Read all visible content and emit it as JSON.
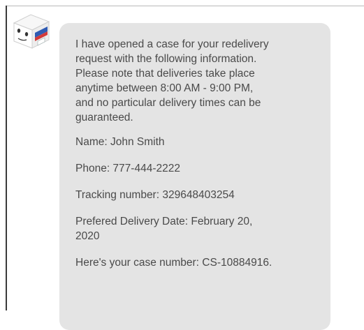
{
  "chat": {
    "agent_avatar": {
      "icon": "package-box-mascot-icon",
      "colors": {
        "body": "#f2f2f2",
        "face_side": "#ffffff",
        "blue_stripe": "#2f5bb3",
        "red_stripe": "#d23a3a",
        "outline": "#c8c8c8",
        "eyes": "#333333"
      }
    },
    "message": {
      "intro": "I have opened a case for your redelivery\nrequest with the following information.\nPlease note that deliveries take place\nanytime between 8:00 AM - 9:00 PM,\nand no particular delivery times can be\nguaranteed.",
      "name_line": "Name: John Smith",
      "phone_line": "Phone: 777-444-2222",
      "tracking_line": "Tracking number: 329648403254",
      "date_line": "Prefered Delivery Date: February 20,\n2020",
      "case_line": "Here's your case number: CS-10884916."
    },
    "colors": {
      "bubble_background": "#e4e4e4",
      "text": "#4a4a4a",
      "page_background": "#ffffff"
    }
  }
}
